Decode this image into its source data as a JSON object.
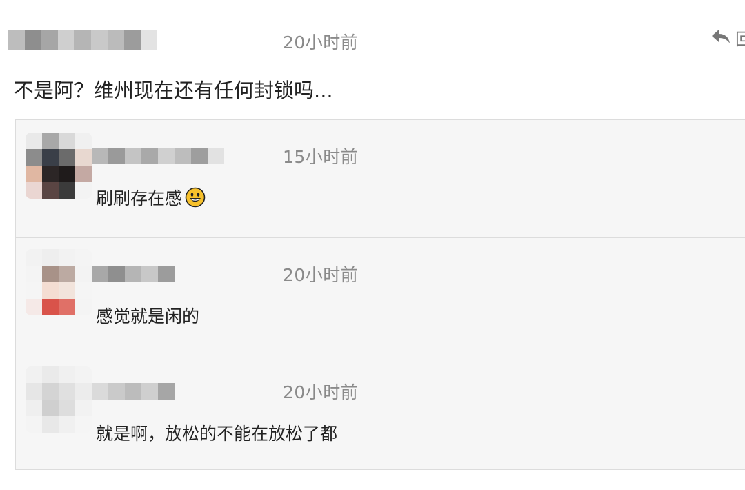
{
  "main_comment": {
    "time": "20小时前",
    "reply_label": "回",
    "text": "不是阿？维州现在还有任何封锁吗..."
  },
  "replies": [
    {
      "time": "15小时前",
      "text": "刷刷存在感",
      "emoji": "grinning-face-emoji"
    },
    {
      "time": "20小时前",
      "text": "感觉就是闲的"
    },
    {
      "time": "20小时前",
      "text": "就是啊，放松的不能在放松了都"
    }
  ],
  "icons": {
    "reply": "reply-arrow-icon"
  },
  "colors": {
    "timestamp": "#8a8a8a",
    "text": "#222222",
    "reply_box_bg": "#f6f6f6",
    "reply_box_border": "#dcdcdc",
    "emoji_yellow": "#f7c12c"
  }
}
